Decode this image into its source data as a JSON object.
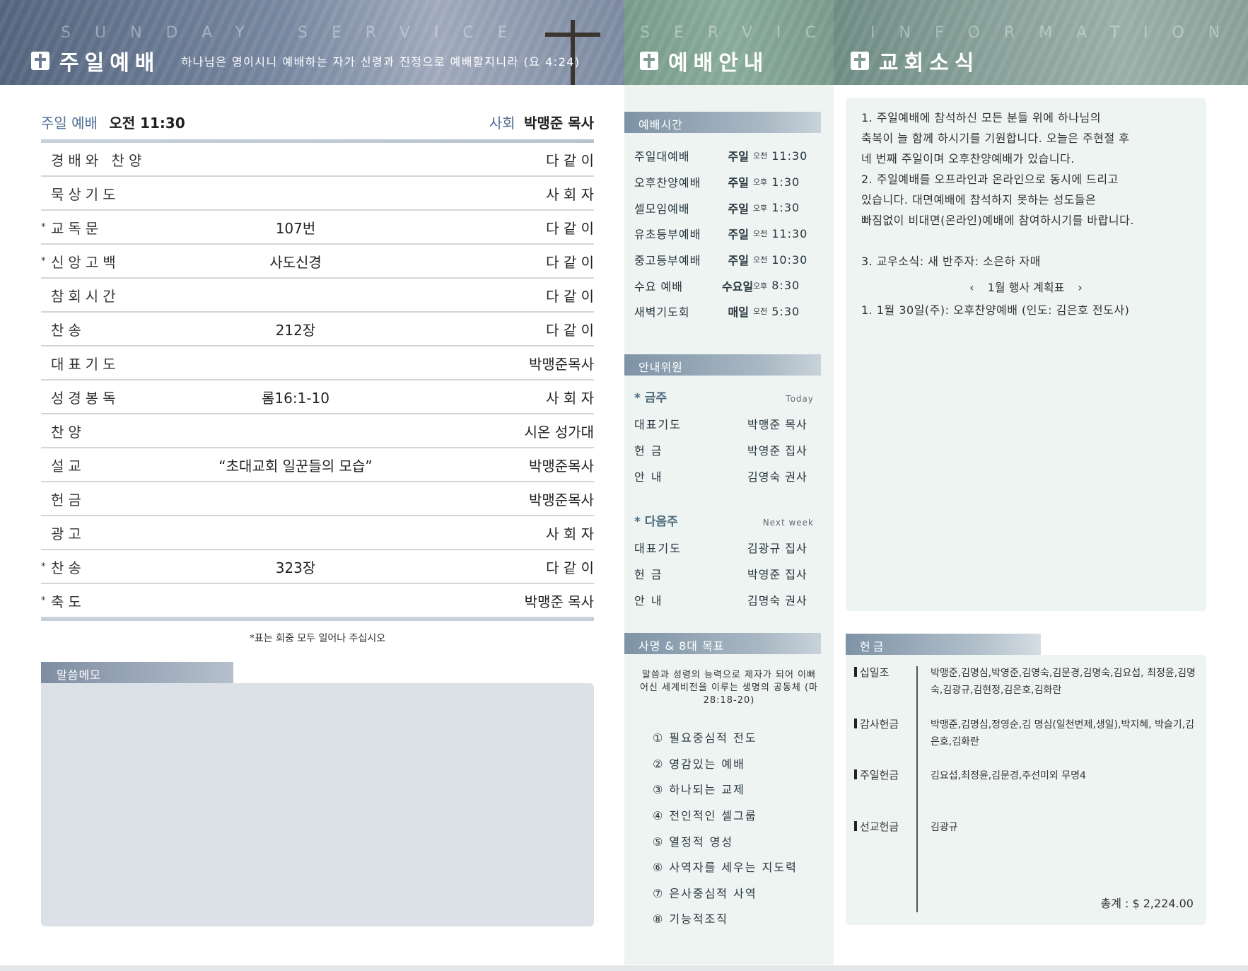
{
  "header": {
    "left": {
      "spaced": "SUNDAY SERVICE",
      "title": "주일예배",
      "verse": "하나님은 영이시니 예배하는 자가 신령과 진정으로 예배할지니라 (요 4:24)"
    },
    "mid": {
      "spaced": "SERVICE",
      "title": "예배안내"
    },
    "right": {
      "spaced": "INFORMATION",
      "title": "교회소식"
    }
  },
  "order": {
    "service_label": "주일 예배",
    "service_time": "오전 11:30",
    "host_label": "사회",
    "host_name": "박맹준 목사",
    "rows": [
      {
        "star": "",
        "name": "경배와 찬양",
        "content": "",
        "leader": "다 같 이"
      },
      {
        "star": "",
        "name": "묵상기도",
        "content": "",
        "leader": "사 회 자"
      },
      {
        "star": "*",
        "name": "교독문",
        "content": "107번",
        "leader": "다 같 이"
      },
      {
        "star": "*",
        "name": "신앙고백",
        "content": "사도신경",
        "leader": "다 같 이"
      },
      {
        "star": "",
        "name": "참회시간",
        "content": "",
        "leader": "다 같 이"
      },
      {
        "star": "",
        "name": "찬송",
        "content": "212장",
        "leader": "다 같 이"
      },
      {
        "star": "",
        "name": "대표기도",
        "content": "",
        "leader": "박맹준목사"
      },
      {
        "star": "",
        "name": "성경봉독",
        "content": "롬16:1-10",
        "leader": "사 회 자"
      },
      {
        "star": "",
        "name": "찬양",
        "content": "",
        "leader": "시온 성가대"
      },
      {
        "star": "",
        "name": "설교",
        "content": "“초대교회 일꾼들의 모습”",
        "leader": "박맹준목사"
      },
      {
        "star": "",
        "name": "헌금",
        "content": "",
        "leader": "박맹준목사"
      },
      {
        "star": "",
        "name": "광고",
        "content": "",
        "leader": "사 회 자"
      },
      {
        "star": "*",
        "name": "찬송",
        "content": "323장",
        "leader": "다 같 이"
      },
      {
        "star": "*",
        "name": "축도",
        "content": "",
        "leader": "박맹준 목사"
      }
    ],
    "note": "*표는 회중 모두 일어나 주십시오"
  },
  "memo": {
    "tab": "말씀메모"
  },
  "service_info": {
    "times_tab": "예배시간",
    "times": [
      {
        "name": "주일대예배",
        "day": "주일",
        "ampm": "오전",
        "time": "11:30"
      },
      {
        "name": "오후찬양예배",
        "day": "주일",
        "ampm": "오후",
        "time": "1:30"
      },
      {
        "name": "셀모임예배",
        "day": "주일",
        "ampm": "오후",
        "time": "1:30"
      },
      {
        "name": "유초등부예배",
        "day": "주일",
        "ampm": "오전",
        "time": "11:30"
      },
      {
        "name": "중고등부예배",
        "day": "주일",
        "ampm": "오전",
        "time": "10:30"
      },
      {
        "name": "수요 예배",
        "day": "수요일",
        "ampm": "오후",
        "time": "8:30"
      },
      {
        "name": "새벽기도회",
        "day": "매일",
        "ampm": "오전",
        "time": "5:30"
      }
    ],
    "staff_tab": "안내위원",
    "this_week": {
      "heading": "* 금주",
      "sub": "Today",
      "rows": [
        {
          "label": "대표기도",
          "value": "박맹준 목사"
        },
        {
          "label": "헌 금",
          "value": "박영준 집사"
        },
        {
          "label": "안 내",
          "value": "김영숙 권사"
        }
      ]
    },
    "next_week": {
      "heading": "* 다음주",
      "sub": "Next week",
      "rows": [
        {
          "label": "대표기도",
          "value": "김광규 집사"
        },
        {
          "label": "헌 금",
          "value": "박영준 집사"
        },
        {
          "label": "안 내",
          "value": "김명숙 권사"
        }
      ]
    },
    "mission_tab": "사명 & 8대 목표",
    "mission_text": "말씀과 성령의 능력으로 제자가 되어 이뻐 어신 세계비전을 이루는 생명의 공동체 (마 28:18-20)",
    "goals": [
      "① 필요중심적 전도",
      "② 영감있는 예배",
      "③ 하나되는 교제",
      "④ 전인적인 셀그룹",
      "⑤ 열정적 영성",
      "⑥ 사역자를 세우는 지도력",
      "⑦ 은사중심적 사역",
      "⑧ 기능적조직"
    ]
  },
  "news": {
    "lines": [
      "1. 주일예배에 참석하신 모든 분들 위에 하나님의",
      "축복이 늘 함께 하시기를 기원합니다. 오늘은 주현절 후",
      "네 번째 주일이며 오후찬양예배가 있습니다.",
      "2. 주일예배를 오프라인과 온라인으로 동시에 드리고",
      "있습니다. 대면예배에 참석하지 못하는 성도들은",
      "빠짐없이 비대면(온라인)예배에 참여하시기를 바랍니다."
    ],
    "line3": "3. 교우소식: 새 반주자: 소은하 자매",
    "events_prev": "‹",
    "events_title": "1월 행사 계획표",
    "events_next": "›",
    "events": [
      "1. 1월 30일(주): 오후찬양예배 (인도: 김은호 전도사)"
    ]
  },
  "offering": {
    "tab": "헌금",
    "rows": [
      {
        "label": "십일조",
        "names": "박맹준,김명심,박영준,김영숙,김문경,김명숙,김요섭, 최정윤,김명숙,김광규,김현정,김은호,김화란"
      },
      {
        "label": "감사헌금",
        "names": "박맹준,김명심,정영순,김 명심(일천번제,생일),박지혜, 박슬기,김은호,김화란"
      },
      {
        "label": "주일헌금",
        "names": "김요섭,최정윤,김문경,주선미외 무명4"
      },
      {
        "label": "선교헌금",
        "names": "김광규"
      }
    ],
    "total": "총계 : $ 2,224.00"
  },
  "colors": {
    "accent_blue": "#4f6e96",
    "panel_green": "#eef4f1",
    "memo_gray": "#dbe1e7"
  }
}
